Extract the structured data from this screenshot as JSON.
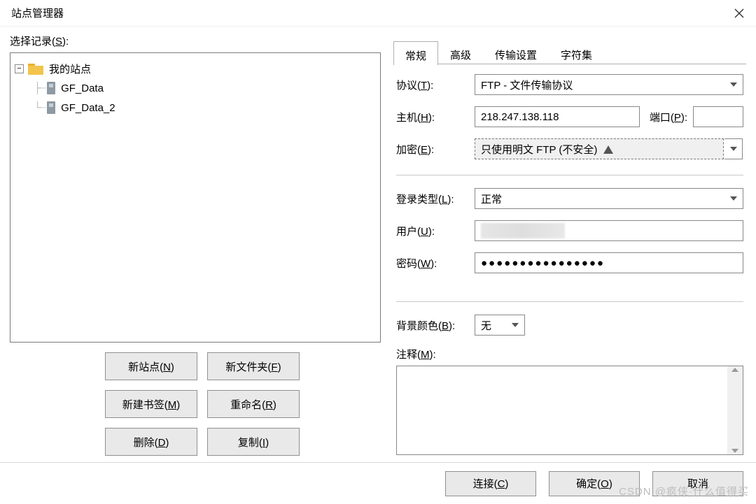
{
  "window": {
    "title": "站点管理器"
  },
  "left": {
    "select_label": "选择记录(S):",
    "tree": {
      "root": "我的站点",
      "children": [
        "GF_Data",
        "GF_Data_2"
      ]
    },
    "buttons": {
      "new_site": "新站点(N)",
      "new_folder": "新文件夹(F)",
      "new_bookmark": "新建书签(M)",
      "rename": "重命名(R)",
      "delete": "删除(D)",
      "copy": "复制(I)"
    }
  },
  "tabs": [
    "常规",
    "高级",
    "传输设置",
    "字符集"
  ],
  "form": {
    "protocol_label": "协议(T):",
    "protocol_value": "FTP - 文件传输协议",
    "host_label": "主机(H):",
    "host_value": "218.247.138.118",
    "port_label": "端口(P):",
    "port_value": "",
    "encrypt_label": "加密(E):",
    "encrypt_value": "只使用明文 FTP (不安全)",
    "logon_label": "登录类型(L):",
    "logon_value": "正常",
    "user_label": "用户(U):",
    "pass_label": "密码(W):",
    "pass_value": "●●●●●●●●●●●●●●●●",
    "bgcolor_label": "背景颜色(B):",
    "bgcolor_value": "无",
    "notes_label": "注释(M):"
  },
  "footer": {
    "connect": "连接(C)",
    "ok": "确定(O)",
    "cancel": "取消"
  },
  "watermark": "CSDN @疯侠·什么值得买"
}
